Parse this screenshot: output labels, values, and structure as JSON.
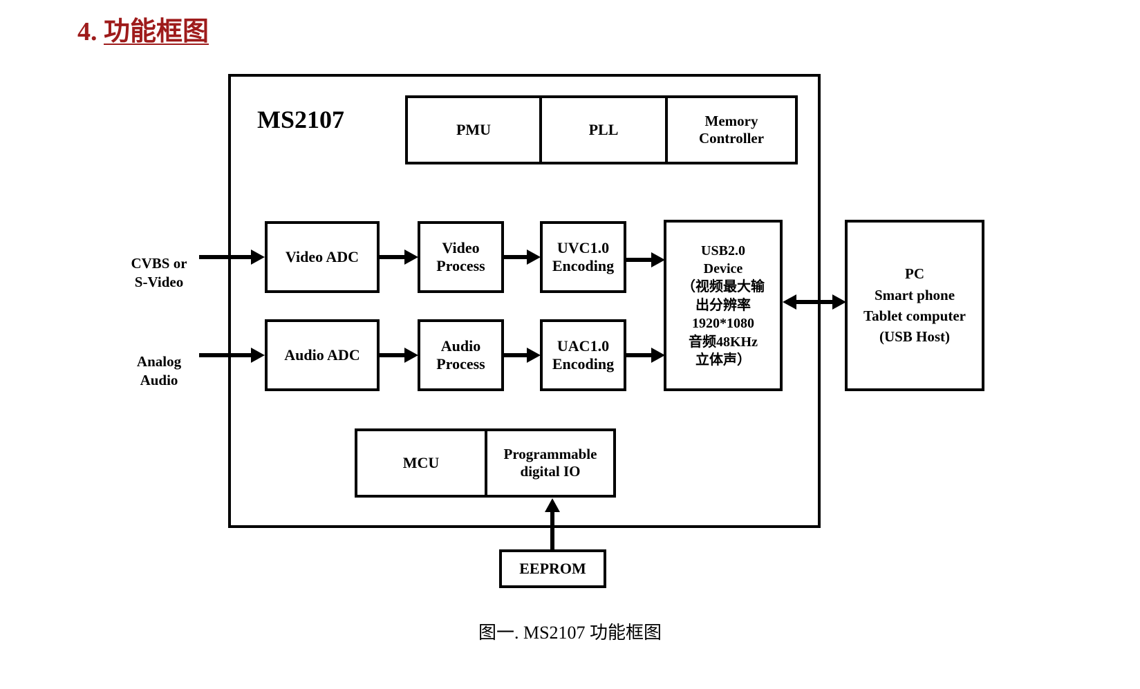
{
  "title": {
    "number": "4.",
    "text": "功能框图"
  },
  "chip": {
    "name": "MS2107"
  },
  "inputs": [
    {
      "id": "video-input",
      "label": "CVBS or\nS-Video"
    },
    {
      "id": "audio-input",
      "label": "Analog\nAudio"
    }
  ],
  "top_row": [
    {
      "id": "pmu",
      "label": "PMU"
    },
    {
      "id": "pll",
      "label": "PLL"
    },
    {
      "id": "memory-controller",
      "label": "Memory\nController"
    }
  ],
  "video_chain": [
    {
      "id": "video-adc",
      "label": "Video ADC"
    },
    {
      "id": "video-process",
      "label": "Video\nProcess"
    },
    {
      "id": "uvc-encoding",
      "label": "UVC1.0\nEncoding"
    }
  ],
  "audio_chain": [
    {
      "id": "audio-adc",
      "label": "Audio ADC"
    },
    {
      "id": "audio-process",
      "label": "Audio\nProcess"
    },
    {
      "id": "uac-encoding",
      "label": "UAC1.0\nEncoding"
    }
  ],
  "usb_device": {
    "label": "USB2.0\nDevice\n（视频最大输\n出分辨率\n1920*1080\n音频48KHz\n立体声）"
  },
  "host": {
    "label": "PC\nSmart phone\nTablet computer\n(USB Host)"
  },
  "mcu_row": [
    {
      "id": "mcu",
      "label": "MCU"
    },
    {
      "id": "programmable-digital-io",
      "label": "Programmable\ndigital IO"
    }
  ],
  "eeprom": {
    "label": "EEPROM"
  },
  "caption": "图一. MS2107 功能框图",
  "colors": {
    "title": "#9E1B1B",
    "line": "#000000",
    "background": "#FFFFFF"
  }
}
